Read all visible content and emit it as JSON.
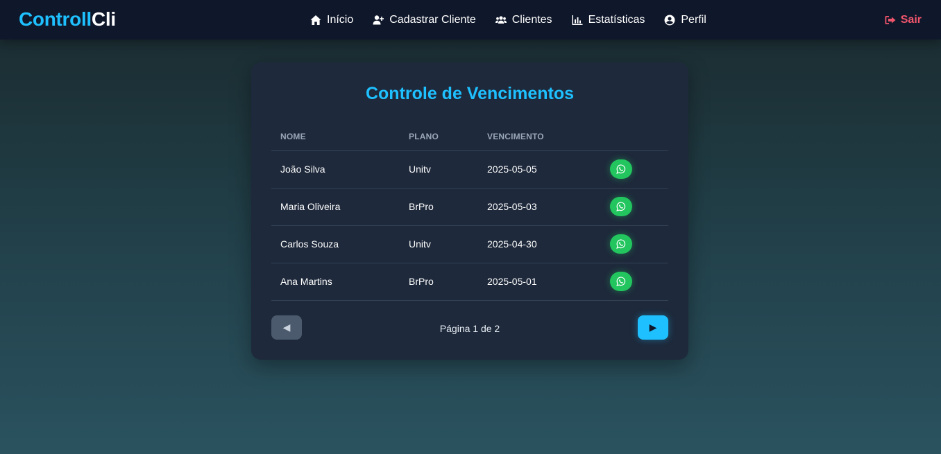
{
  "brand": {
    "part1": "Controll",
    "part2": "Cli"
  },
  "nav": {
    "items": [
      {
        "label": "Início",
        "icon": "home-icon"
      },
      {
        "label": "Cadastrar Cliente",
        "icon": "user-plus-icon"
      },
      {
        "label": "Clientes",
        "icon": "users-icon"
      },
      {
        "label": "Estatísticas",
        "icon": "chart-icon"
      },
      {
        "label": "Perfil",
        "icon": "user-circle-icon"
      }
    ],
    "logout_label": "Sair"
  },
  "main": {
    "title": "Controle de Vencimentos",
    "columns": [
      "NOME",
      "PLANO",
      "VENCIMENTO"
    ],
    "rows": [
      {
        "nome": "João Silva",
        "plano": "Unitv",
        "vencimento": "2025-05-05"
      },
      {
        "nome": "Maria Oliveira",
        "plano": "BrPro",
        "vencimento": "2025-05-03"
      },
      {
        "nome": "Carlos Souza",
        "plano": "Unitv",
        "vencimento": "2025-04-30"
      },
      {
        "nome": "Ana Martins",
        "plano": "BrPro",
        "vencimento": "2025-05-01"
      }
    ],
    "pagination": {
      "text": "Página 1 de 2",
      "prev": "◀",
      "next": "▶"
    }
  },
  "colors": {
    "accent": "#1ec0ff",
    "whatsapp": "#22c55e",
    "logout": "#f1556c"
  }
}
